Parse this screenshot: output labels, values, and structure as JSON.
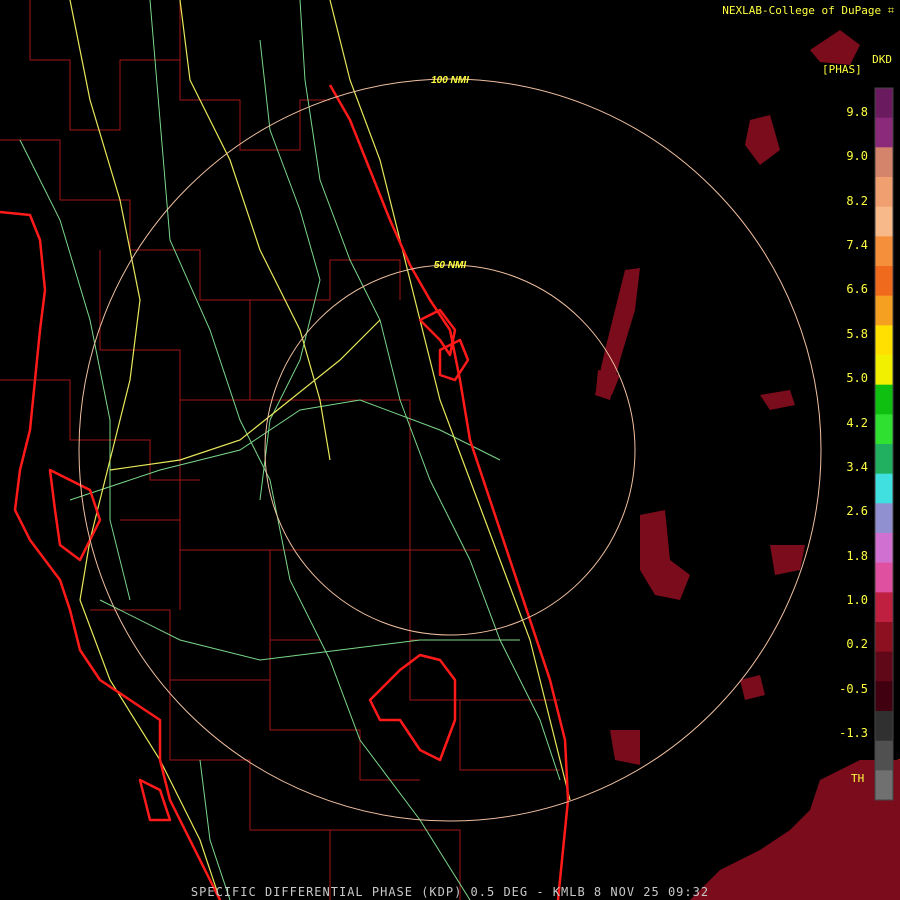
{
  "header": {
    "credit": "NEXLAB-College of DuPage",
    "product_code": "DKD",
    "units": "[PHAS]"
  },
  "footer": {
    "caption": "SPECIFIC DIFFERENTIAL PHASE (KDP) 0.5 DEG - KMLB 8 NOV 25 09:32"
  },
  "range_rings": [
    {
      "label": "100 NMI",
      "nmi": 100
    },
    {
      "label": "50 NMI",
      "nmi": 50
    }
  ],
  "legend": {
    "title": "[PHAS]",
    "ticks": [
      "9.8",
      "9.0",
      "8.2",
      "7.4",
      "6.6",
      "5.8",
      "5.0",
      "4.2",
      "3.4",
      "2.6",
      "1.8",
      "1.0",
      "0.2",
      "-0.5",
      "-1.3"
    ],
    "threshold_label": "TH",
    "colors": [
      "#6a1a5e",
      "#8b2a7a",
      "#d4846a",
      "#f0a070",
      "#f7b98a",
      "#f58f3c",
      "#f06a1e",
      "#f5a020",
      "#ffe000",
      "#f0f000",
      "#10c010",
      "#30e030",
      "#20b060",
      "#40e0e0",
      "#9090d0",
      "#d070d0",
      "#e050a0",
      "#c02040",
      "#8c1020",
      "#600818",
      "#400010",
      "#303030",
      "#505050",
      "#707070"
    ]
  },
  "colors": {
    "background": "#000000",
    "coastline": "#ff1a1a",
    "county_lines": "#a01818",
    "highways": "#e8e85a",
    "roads": "#7ad88a",
    "range_ring": "#f0c0a0",
    "label_text": "#ffff40",
    "echo": "#7a0c1c"
  },
  "radar": {
    "site": "KMLB"
  }
}
